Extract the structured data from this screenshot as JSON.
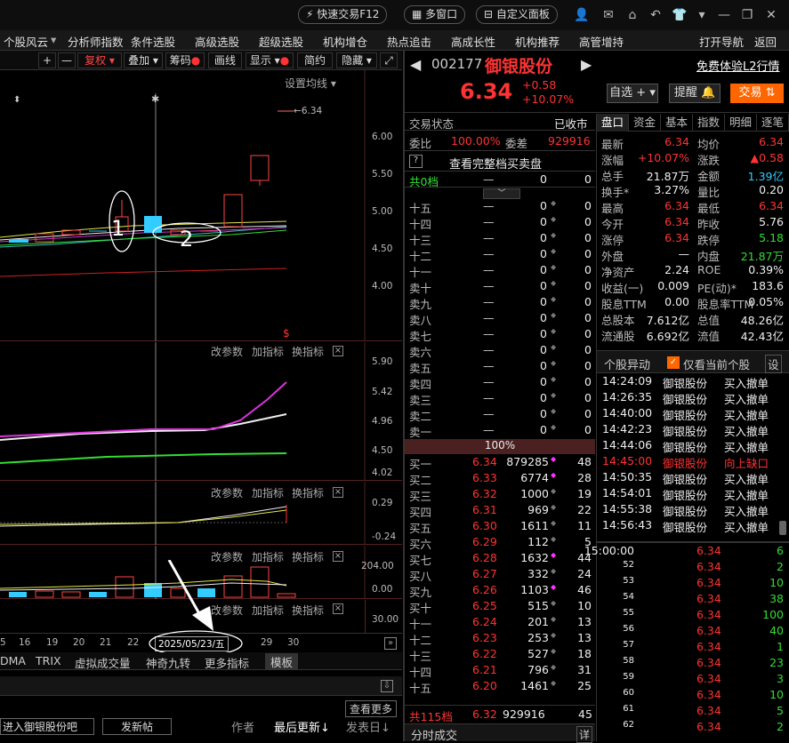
{
  "topbar": {
    "quick_trade": "快速交易F12",
    "multi_window": "多窗口",
    "custom_panel": "自定义面板"
  },
  "menu": [
    "个股风云",
    "分析师指数",
    "条件选股",
    "高级选股",
    "超级选股",
    "机构增仓",
    "热点追击",
    "高成长性",
    "机构推荐",
    "高管增持",
    "打开导航",
    "返回"
  ],
  "chart_toolbar": {
    "plus": "+",
    "minus": "—",
    "fuquan": "复权",
    "diejia": "叠加",
    "chouma": "筹码",
    "huaxian": "画线",
    "xianshi": "显示",
    "jianyue": "简约",
    "yincang": "隐藏"
  },
  "main_chart": {
    "setting": "设置均线",
    "price_marker": "6.34",
    "y_ticks": [
      "6.00",
      "5.50",
      "5.00",
      "4.50",
      "4.00"
    ],
    "annot1": "1",
    "annot2": "2"
  },
  "pane2": {
    "y_ticks": [
      "5.90",
      "5.42",
      "4.96",
      "4.50",
      "4.02"
    ]
  },
  "pane3": {
    "y_ticks": [
      "0.29",
      "-0.24"
    ]
  },
  "pane4": {
    "y_ticks": [
      "204.00",
      "0.00"
    ]
  },
  "pane5": {
    "y_ticks": [
      "30.00"
    ]
  },
  "pane_labels": {
    "param": "改参数",
    "add": "加指标",
    "change": "换指标",
    "close": "×"
  },
  "x_axis": {
    "labels": [
      "5",
      "16",
      "19",
      "20",
      "21",
      "22",
      "2025/05/23/五",
      "29",
      "30"
    ]
  },
  "chart_tabs": [
    "DMA",
    "TRIX",
    "虚拟成交量",
    "神奇九转",
    "更多指标",
    "模板"
  ],
  "bottom": {
    "forum": "进入御银股份吧",
    "post": "发新帖",
    "view_more": "查看更多",
    "author": "作者",
    "latest": "最后更新↓",
    "post_date": "发表日↓"
  },
  "stock": {
    "code": "002177",
    "name": "御银股份",
    "price": "6.34",
    "change": "+0.58",
    "pct": "+10.07%",
    "free_l2": "免费体验L2行情",
    "zixuan": "自选",
    "tixing": "提醒",
    "jiaoyi": "交易"
  },
  "orderbook": {
    "status_label": "交易状态",
    "status_value": "已收市",
    "weibi_label": "委比",
    "weibi_value": "100.00%",
    "weicha_label": "委差",
    "weicha_value": "929916",
    "full_book": "查看完整档买卖盘",
    "total_sell": {
      "label": "共0档",
      "price": "—",
      "vol": "0",
      "count": "0"
    },
    "sells": [
      {
        "label": "十五",
        "price": "—",
        "vol": "0",
        "count": "0"
      },
      {
        "label": "十四",
        "price": "—",
        "vol": "0",
        "count": "0"
      },
      {
        "label": "十三",
        "price": "—",
        "vol": "0",
        "count": "0"
      },
      {
        "label": "十二",
        "price": "—",
        "vol": "0",
        "count": "0"
      },
      {
        "label": "十一",
        "price": "—",
        "vol": "0",
        "count": "0"
      },
      {
        "label": "卖十",
        "price": "—",
        "vol": "0",
        "count": "0"
      },
      {
        "label": "卖九",
        "price": "—",
        "vol": "0",
        "count": "0"
      },
      {
        "label": "卖八",
        "price": "—",
        "vol": "0",
        "count": "0"
      },
      {
        "label": "卖七",
        "price": "—",
        "vol": "0",
        "count": "0"
      },
      {
        "label": "卖六",
        "price": "—",
        "vol": "0",
        "count": "0"
      },
      {
        "label": "卖五",
        "price": "—",
        "vol": "0",
        "count": "0"
      },
      {
        "label": "卖四",
        "price": "—",
        "vol": "0",
        "count": "0"
      },
      {
        "label": "卖三",
        "price": "—",
        "vol": "0",
        "count": "0"
      },
      {
        "label": "卖二",
        "price": "—",
        "vol": "0",
        "count": "0"
      },
      {
        "label": "卖一",
        "price": "—",
        "vol": "0",
        "count": "0"
      }
    ],
    "ratio": "100%",
    "buys": [
      {
        "label": "买一",
        "price": "6.34",
        "vol": "879285",
        "count": "48"
      },
      {
        "label": "买二",
        "price": "6.33",
        "vol": "6774",
        "count": "28"
      },
      {
        "label": "买三",
        "price": "6.32",
        "vol": "1000",
        "count": "19"
      },
      {
        "label": "买四",
        "price": "6.31",
        "vol": "969",
        "count": "22"
      },
      {
        "label": "买五",
        "price": "6.30",
        "vol": "1611",
        "count": "11"
      },
      {
        "label": "买六",
        "price": "6.29",
        "vol": "112",
        "count": "5"
      },
      {
        "label": "买七",
        "price": "6.28",
        "vol": "1632",
        "count": "44"
      },
      {
        "label": "买八",
        "price": "6.27",
        "vol": "332",
        "count": "24"
      },
      {
        "label": "买九",
        "price": "6.26",
        "vol": "1103",
        "count": "46"
      },
      {
        "label": "买十",
        "price": "6.25",
        "vol": "515",
        "count": "10"
      },
      {
        "label": "十一",
        "price": "6.24",
        "vol": "201",
        "count": "13"
      },
      {
        "label": "十二",
        "price": "6.23",
        "vol": "253",
        "count": "13"
      },
      {
        "label": "十三",
        "price": "6.22",
        "vol": "527",
        "count": "18"
      },
      {
        "label": "十四",
        "price": "6.21",
        "vol": "796",
        "count": "31"
      },
      {
        "label": "十五",
        "price": "6.20",
        "vol": "1461",
        "count": "25"
      }
    ],
    "total_buy": {
      "label": "共115档",
      "price": "6.32",
      "vol": "929916",
      "count": "45"
    },
    "fenshi": "分时成交",
    "detail": "详"
  },
  "right_tabs": [
    "盘口",
    "资金",
    "基本",
    "指数",
    "明细",
    "逐笔"
  ],
  "quote": [
    {
      "l1": "最新",
      "v1": "6.34",
      "l2": "均价",
      "v2": "6.34"
    },
    {
      "l1": "涨幅",
      "v1": "+10.07%",
      "l2": "涨跌",
      "v2": "▲0.58"
    },
    {
      "l1": "总手",
      "v1": "21.87万",
      "l2": "金额",
      "v2": "1.39亿"
    },
    {
      "l1": "换手*",
      "v1": "3.27%",
      "l2": "量比",
      "v2": "0.20"
    },
    {
      "l1": "最高",
      "v1": "6.34",
      "l2": "最低",
      "v2": "6.34"
    },
    {
      "l1": "今开",
      "v1": "6.34",
      "l2": "昨收",
      "v2": "5.76"
    },
    {
      "l1": "涨停",
      "v1": "6.34",
      "l2": "跌停",
      "v2": "5.18"
    },
    {
      "l1": "外盘",
      "v1": "—",
      "l2": "内盘",
      "v2": "21.87万"
    },
    {
      "l1": "净资产",
      "v1": "2.24",
      "l2": "ROE",
      "v2": "0.39%"
    },
    {
      "l1": "收益(一)",
      "v1": "0.009",
      "l2": "PE(动)*",
      "v2": "183.6"
    },
    {
      "l1": "股息TTM",
      "v1": "0.00",
      "l2": "股息率TTM",
      "v2": "0.05%"
    },
    {
      "l1": "总股本",
      "v1": "7.612亿",
      "l2": "总值",
      "v2": "48.26亿"
    },
    {
      "l1": "流通股",
      "v1": "6.692亿",
      "l2": "流值",
      "v2": "42.43亿"
    }
  ],
  "abnormal": {
    "title": "个股异动",
    "only_current": "仅看当前个股",
    "settings": "设",
    "rows": [
      {
        "time": "14:24:09",
        "name": "御银股份",
        "event": "买入撤单",
        "hl": false
      },
      {
        "time": "14:26:35",
        "name": "御银股份",
        "event": "买入撤单",
        "hl": false
      },
      {
        "time": "14:40:00",
        "name": "御银股份",
        "event": "买入撤单",
        "hl": false
      },
      {
        "time": "14:42:23",
        "name": "御银股份",
        "event": "买入撤单",
        "hl": false
      },
      {
        "time": "14:44:06",
        "name": "御银股份",
        "event": "买入撤单",
        "hl": false
      },
      {
        "time": "14:45:00",
        "name": "御银股份",
        "event": "向上缺口",
        "hl": true
      },
      {
        "time": "14:50:35",
        "name": "御银股份",
        "event": "买入撤单",
        "hl": false
      },
      {
        "time": "14:54:01",
        "name": "御银股份",
        "event": "买入撤单",
        "hl": false
      },
      {
        "time": "14:55:38",
        "name": "御银股份",
        "event": "买入撤单",
        "hl": false
      },
      {
        "time": "14:56:43",
        "name": "御银股份",
        "event": "买入撤单",
        "hl": false
      }
    ]
  },
  "ticks": [
    {
      "t": "15:00:00",
      "p": "6.34",
      "v": "6"
    },
    {
      "t": "52",
      "p": "6.34",
      "v": "2"
    },
    {
      "t": "53",
      "p": "6.34",
      "v": "10"
    },
    {
      "t": "54",
      "p": "6.34",
      "v": "38"
    },
    {
      "t": "55",
      "p": "6.34",
      "v": "100"
    },
    {
      "t": "56",
      "p": "6.34",
      "v": "40"
    },
    {
      "t": "57",
      "p": "6.34",
      "v": "1"
    },
    {
      "t": "58",
      "p": "6.34",
      "v": "23"
    },
    {
      "t": "59",
      "p": "6.34",
      "v": "3"
    },
    {
      "t": "60",
      "p": "6.34",
      "v": "10"
    },
    {
      "t": "61",
      "p": "6.34",
      "v": "5"
    },
    {
      "t": "62",
      "p": "6.34",
      "v": "2"
    }
  ],
  "colors": {
    "up": "#ff3333",
    "down": "#33dd33",
    "accent": "#ff6600"
  }
}
